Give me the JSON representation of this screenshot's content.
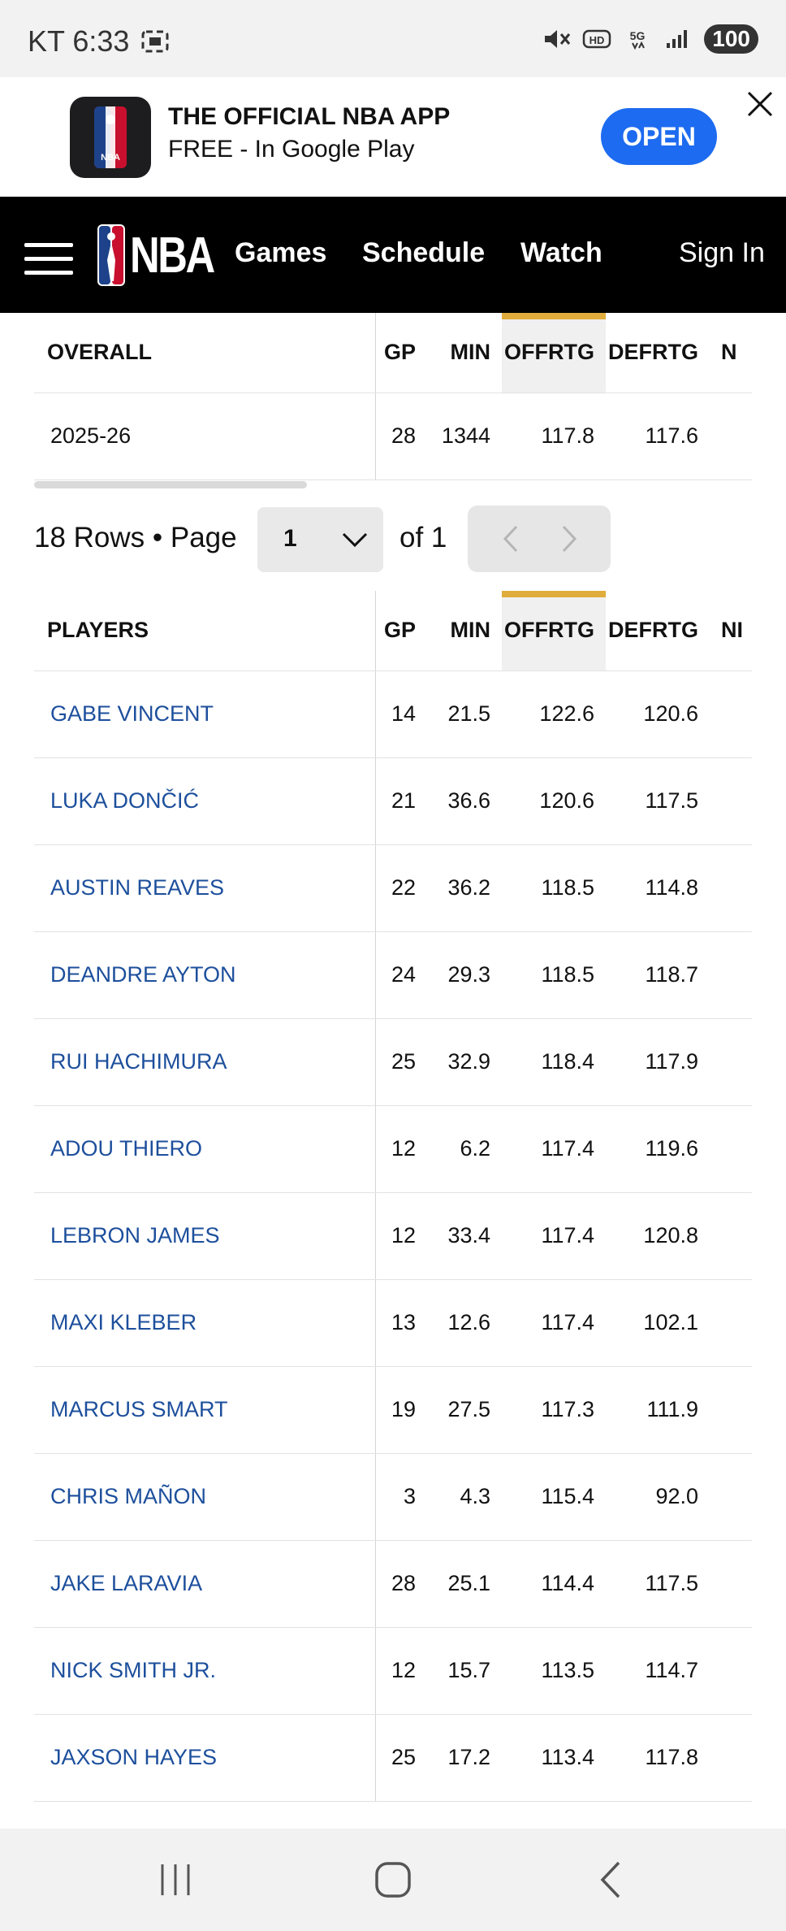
{
  "status": {
    "carrier_time": "KT 6:33",
    "battery": "100"
  },
  "banner": {
    "title": "THE OFFICIAL NBA APP",
    "subtitle": "FREE - In Google Play",
    "open_label": "OPEN",
    "logo_text": "NBA"
  },
  "nav": {
    "logo_text": "NBA",
    "links": [
      "Games",
      "Schedule",
      "Watch"
    ],
    "sign_in": "Sign In"
  },
  "overall_table": {
    "headers": [
      "OVERALL",
      "GP",
      "MIN",
      "OFFRTG",
      "DEFRTG",
      "N"
    ],
    "row": [
      "2025-26",
      "28",
      "1344",
      "117.8",
      "117.6"
    ]
  },
  "pager": {
    "rows_label": "18 Rows • Page",
    "page_value": "1",
    "of_label": "of 1"
  },
  "players_table": {
    "headers": [
      "PLAYERS",
      "GP",
      "MIN",
      "OFFRTG",
      "DEFRTG",
      "NI"
    ],
    "rows": [
      [
        "GABE VINCENT",
        "14",
        "21.5",
        "122.6",
        "120.6"
      ],
      [
        "LUKA DONČIĆ",
        "21",
        "36.6",
        "120.6",
        "117.5"
      ],
      [
        "AUSTIN REAVES",
        "22",
        "36.2",
        "118.5",
        "114.8"
      ],
      [
        "DEANDRE AYTON",
        "24",
        "29.3",
        "118.5",
        "118.7"
      ],
      [
        "RUI HACHIMURA",
        "25",
        "32.9",
        "118.4",
        "117.9"
      ],
      [
        "ADOU THIERO",
        "12",
        "6.2",
        "117.4",
        "119.6"
      ],
      [
        "LEBRON JAMES",
        "12",
        "33.4",
        "117.4",
        "120.8"
      ],
      [
        "MAXI KLEBER",
        "13",
        "12.6",
        "117.4",
        "102.1"
      ],
      [
        "MARCUS SMART",
        "19",
        "27.5",
        "117.3",
        "111.9"
      ],
      [
        "CHRIS MAÑON",
        "3",
        "4.3",
        "115.4",
        "92.0"
      ],
      [
        "JAKE LARAVIA",
        "28",
        "25.1",
        "114.4",
        "117.5"
      ],
      [
        "NICK SMITH JR.",
        "12",
        "15.7",
        "113.5",
        "114.7"
      ],
      [
        "JAXSON HAYES",
        "25",
        "17.2",
        "113.4",
        "117.8"
      ]
    ]
  },
  "colors": {
    "nav_bg": "#000000",
    "link": "#1d4f9c",
    "sort_accent": "#e0ac3c",
    "open_button": "#1d6bf0"
  }
}
